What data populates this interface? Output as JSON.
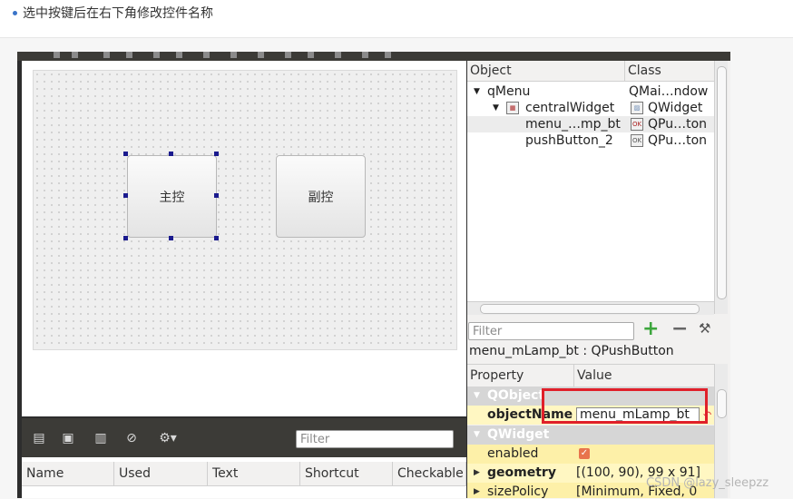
{
  "caption": {
    "text": "选中按键后在右下角修改控件名称"
  },
  "form": {
    "button_main": "主控",
    "button_sub": "副控"
  },
  "action_editor": {
    "filter_placeholder": "Filter",
    "columns": [
      "Name",
      "Used",
      "Text",
      "Shortcut",
      "Checkable"
    ]
  },
  "object_inspector": {
    "col_object": "Object",
    "col_class": "Class",
    "rows": [
      {
        "name": "qMenu",
        "class": "QMai…ndow"
      },
      {
        "name": "centralWidget",
        "class": "QWidget"
      },
      {
        "name": "menu_…mp_bt",
        "class": "QPu…ton"
      },
      {
        "name": "pushButton_2",
        "class": "QPu…ton"
      }
    ]
  },
  "property_editor": {
    "filter_placeholder": "Filter",
    "object_title": "menu_mLamp_bt : QPushButton",
    "col_property": "Property",
    "col_value": "Value",
    "group_qobject": "QObject",
    "object_name_label": "objectName",
    "object_name_value": "menu_mLamp_bt",
    "group_qwidget": "QWidget",
    "enabled_label": "enabled",
    "geometry_label": "geometry",
    "geometry_value": "[(100, 90), 99 x 91]",
    "size_policy_label": "sizePolicy",
    "size_policy_value": "[Minimum, Fixed, 0"
  },
  "watermark": "CSDN @lazy_sleepzz"
}
